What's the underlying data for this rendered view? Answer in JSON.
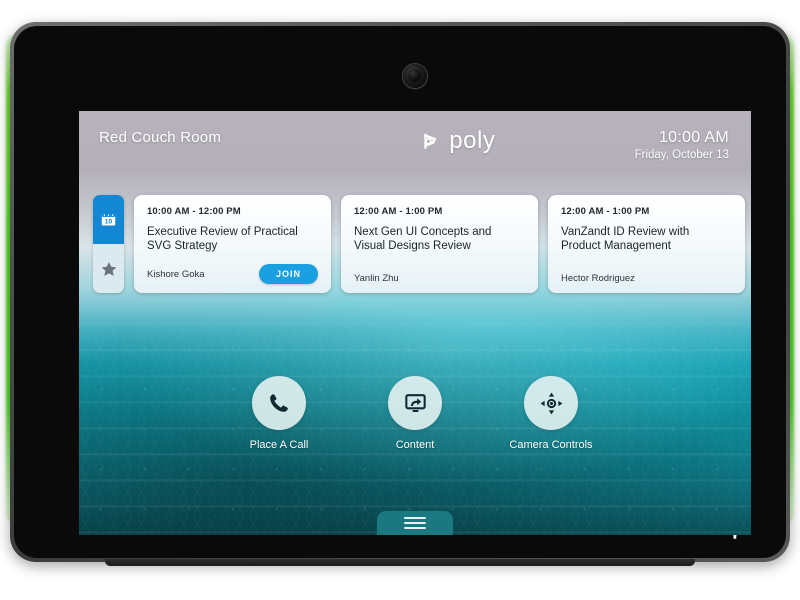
{
  "device": {
    "name": "poly-video-conference-tablet",
    "camera_label": "front-camera",
    "bezel_logo": "poly-mark",
    "led_color": "#4ddb1f"
  },
  "topbar": {
    "room_name": "Red Couch Room",
    "brand": "poly",
    "time": "10:00 AM",
    "date": "Friday, October 13"
  },
  "rail": {
    "calendar_day": "10",
    "calendar_icon": "calendar-icon",
    "favorites_icon": "star-icon"
  },
  "meetings": [
    {
      "time": "10:00 AM - 12:00 PM",
      "title": "Executive Review of Practical SVG Strategy",
      "organizer": "Kishore Goka",
      "join_label": "JOIN",
      "has_join": true
    },
    {
      "time": "12:00 AM - 1:00 PM",
      "title": "Next Gen UI Concepts and Visual Designs Review",
      "organizer": "Yanlin Zhu",
      "join_label": "",
      "has_join": false
    },
    {
      "time": "12:00 AM - 1:00 PM",
      "title": "VanZandt ID Review with Product Management",
      "organizer": "Hector Rodriguez",
      "join_label": "",
      "has_join": false
    }
  ],
  "actions": [
    {
      "label": "Place A Call",
      "icon": "phone-icon"
    },
    {
      "label": "Content",
      "icon": "screen-share-icon"
    },
    {
      "label": "Camera Controls",
      "icon": "camera-pan-tilt-icon"
    }
  ],
  "bottom_tab": {
    "icon": "hamburger-menu-icon"
  },
  "colors": {
    "accent_blue": "#1288d4",
    "join_blue": "#1a9fe0",
    "teal": "#17a0b2",
    "led_green": "#4ddb1f"
  }
}
